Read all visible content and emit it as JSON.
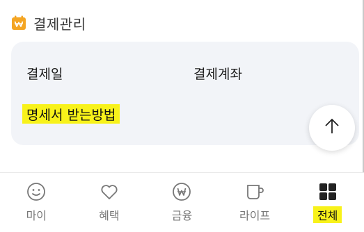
{
  "section": {
    "title": "결제관리",
    "icon": "calendar-won-icon",
    "icon_color": "#f4a523"
  },
  "card": {
    "payment_date_label": "결제일",
    "payment_account_label": "결제계좌",
    "statement_guide_link": "명세서 받는방법",
    "scroll_top_icon": "arrow-up-icon",
    "background": "#f2f4f8"
  },
  "bottom_nav": {
    "items": [
      {
        "label": "마이",
        "icon": "smiley-icon"
      },
      {
        "label": "혜택",
        "icon": "heart-icon"
      },
      {
        "label": "금융",
        "icon": "won-coin-icon"
      },
      {
        "label": "라이프",
        "icon": "cup-icon"
      },
      {
        "label": "전체",
        "icon": "grid-icon",
        "active": true
      }
    ],
    "highlight_color": "#f8f21a"
  }
}
